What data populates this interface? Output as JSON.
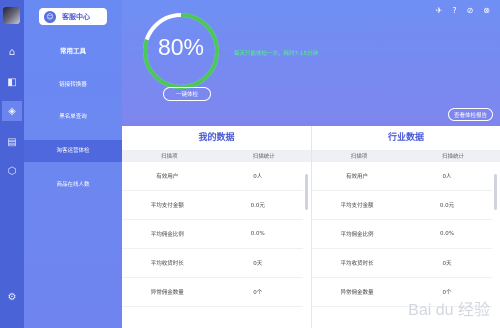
{
  "sidebar": {
    "service_button": "客服中心",
    "section_header": "常用工具",
    "items": [
      {
        "label": "链接转换器"
      },
      {
        "label": "黑名单查询"
      },
      {
        "label": "淘客运营体检"
      },
      {
        "label": "商品在线人数"
      }
    ]
  },
  "checkup": {
    "score": "80%",
    "score_fraction": 0.8,
    "button": "一键体检",
    "tip": "每天只能体检一次，耗时7-15分钟",
    "report_button": "查看体检报告"
  },
  "my_data": {
    "title": "我的数据",
    "columns": [
      "扫描项",
      "扫描统计"
    ],
    "rows": [
      [
        "有效用户",
        "0人"
      ],
      [
        "平均支付金额",
        "0.0元"
      ],
      [
        "平均佣金比例",
        "0.0%"
      ],
      [
        "平均收货时长",
        "0天"
      ],
      [
        "异常佣金数量",
        "0个"
      ]
    ]
  },
  "industry_data": {
    "title": "行业数据",
    "columns": [
      "扫描项",
      "扫描统计"
    ],
    "rows": [
      [
        "有效用户",
        "0人"
      ],
      [
        "平均支付金额",
        "0.0元"
      ],
      [
        "平均佣金比例",
        "0.0%"
      ],
      [
        "平均收货时长",
        "0天"
      ],
      [
        "异常佣金数量",
        "0个"
      ]
    ]
  },
  "watermark": "Bai du 经验",
  "colors": {
    "accent": "#4a63d6",
    "ring": "#4cc85a",
    "tip": "#4aff74"
  }
}
